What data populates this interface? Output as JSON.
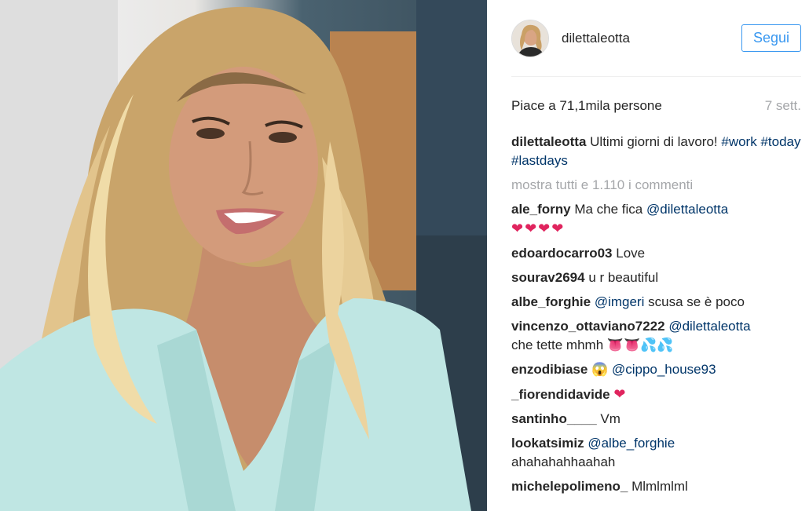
{
  "post": {
    "author": "dilettaleotta",
    "follow_label": "Segui",
    "likes_text": "Piace a 71,1mila persone",
    "time": "7 sett.",
    "caption_text": "Ultimi giorni di lavoro!",
    "hashtags": [
      "#work",
      "#today",
      "#lastdays"
    ],
    "load_more": "mostra tutti e 1.110 i commenti"
  },
  "comments": [
    {
      "user": "ale_forny",
      "text": "Ma che fica",
      "mention": "@dilettaleotta",
      "hearts": "❤❤❤❤"
    },
    {
      "user": "edoardocarro03",
      "text": "Love"
    },
    {
      "user": "sourav2694",
      "text": "u r beautiful"
    },
    {
      "user": "albe_forghie",
      "mention": "@imgeri",
      "text": "scusa se è poco"
    },
    {
      "user": "vincenzo_ottaviano7222",
      "mention": "@dilettaleotta",
      "text": "che tette mhmh",
      "emoji": "👅👅💦💦"
    },
    {
      "user": "enzodibiase",
      "emoji": "😱",
      "mention": "@cippo_house93"
    },
    {
      "user": "_fiorendidavide",
      "hearts": "❤"
    },
    {
      "user": "santinho____",
      "text": "Vm"
    },
    {
      "user": "lookatsimiz",
      "mention": "@albe_forghie",
      "text": "ahahahahhaahah"
    },
    {
      "user": "michelepolimeno_",
      "text": "Mlmlmlml"
    }
  ],
  "colors": {
    "link": "#003569",
    "follow": "#3897f0",
    "muted": "#a5a7aa",
    "heart": "#e0245e"
  }
}
